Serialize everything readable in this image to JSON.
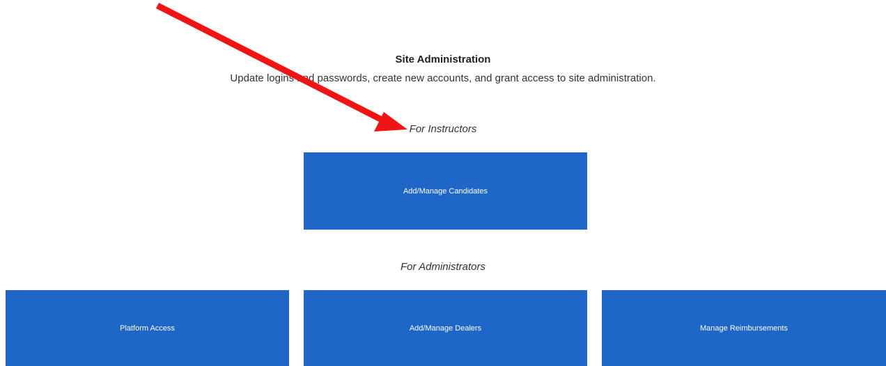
{
  "header": {
    "title": "Site Administration",
    "subtitle": "Update logins and passwords, create new accounts, and grant access to site administration."
  },
  "sections": {
    "instructors": {
      "heading": "For Instructors",
      "tiles": [
        {
          "label": "Add/Manage Candidates"
        }
      ]
    },
    "administrators": {
      "heading": "For Administrators",
      "tiles": [
        {
          "label": "Platform Access"
        },
        {
          "label": "Add/Manage Dealers"
        },
        {
          "label": "Manage Reimbursements"
        }
      ]
    }
  },
  "colors": {
    "tile_bg": "#1f66c9",
    "annotation_arrow": "#f01515"
  }
}
